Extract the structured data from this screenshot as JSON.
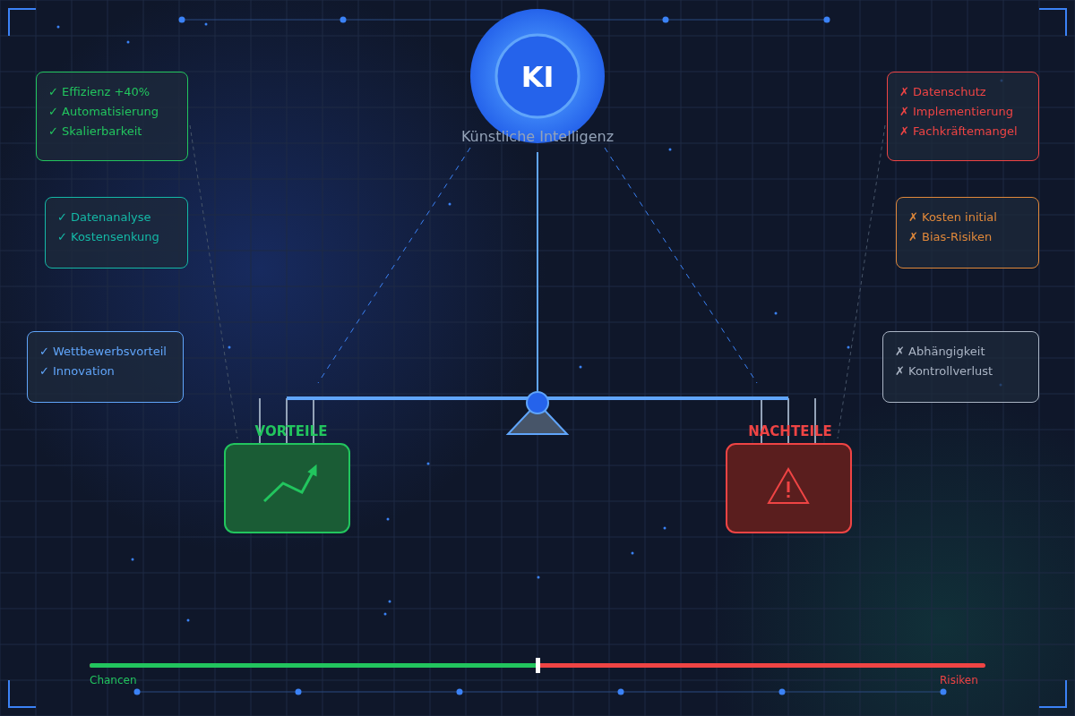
{
  "center": {
    "logo": "KI",
    "label": "Künstliche Intelligenz"
  },
  "advantages": {
    "title": "VORTEILE",
    "cards": [
      {
        "color": "#22c55e",
        "items": [
          "✓ Effizienz +40%",
          "✓ Automatisierung",
          "✓ Skalierbarkeit"
        ]
      },
      {
        "color": "#14b8a6",
        "items": [
          "✓ Datenanalyse",
          "✓ Kostensenkung"
        ]
      },
      {
        "color": "#60a5fa",
        "items": [
          "✓ Wettbewerbsvorteil",
          "✓ Innovation"
        ]
      }
    ]
  },
  "disadvantages": {
    "title": "NACHTEILE",
    "cards": [
      {
        "color": "#ef4444",
        "items": [
          "✗ Datenschutz",
          "✗ Implementierung",
          "✗ Fachkräftemangel"
        ]
      },
      {
        "color": "#e0883a",
        "items": [
          "✗ Kosten initial",
          "✗ Bias-Risiken"
        ]
      },
      {
        "color": "#aab4c4",
        "items": [
          "✗ Abhängigkeit",
          "✗ Kontrollverlust"
        ]
      }
    ]
  },
  "balance": {
    "level": 0.5,
    "left_label": "Chancen",
    "right_label": "Risiken"
  }
}
